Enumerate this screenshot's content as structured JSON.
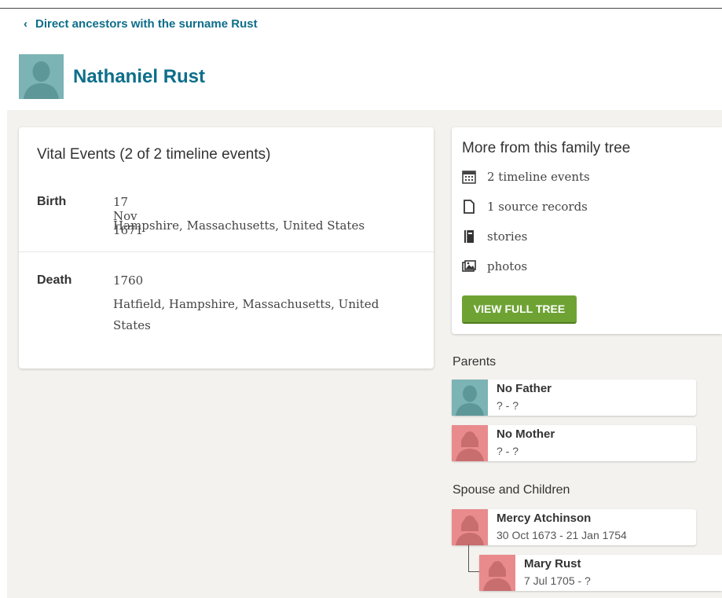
{
  "breadcrumb": {
    "label": "Direct ancestors with the surname Rust"
  },
  "person": {
    "name": "Nathaniel Rust"
  },
  "vital_events": {
    "title": "Vital Events (2 of 2 timeline events)",
    "events": [
      {
        "label": "Birth",
        "date": "17 Nov 1671",
        "place": "Hampshire, Massachusetts, United States"
      },
      {
        "label": "Death",
        "date": "1760",
        "place": "Hatfield, Hampshire, Massachusetts, United States"
      }
    ]
  },
  "more": {
    "title": "More from this family tree",
    "items": [
      {
        "icon": "calendar-icon",
        "label": "2 timeline events"
      },
      {
        "icon": "document-icon",
        "label": "1 source records"
      },
      {
        "icon": "book-icon",
        "label": "stories"
      },
      {
        "icon": "photos-icon",
        "label": "photos"
      }
    ],
    "button": "VIEW FULL TREE"
  },
  "parents": {
    "label": "Parents",
    "items": [
      {
        "name": "No Father",
        "dates": "? - ?",
        "gender": "male"
      },
      {
        "name": "No Mother",
        "dates": "? - ?",
        "gender": "female"
      }
    ]
  },
  "spouse_children": {
    "label": "Spouse and Children",
    "spouse": {
      "name": "Mercy Atchinson",
      "dates": "30 Oct 1673 - 21 Jan 1754",
      "gender": "female"
    },
    "children": [
      {
        "name": "Mary Rust",
        "dates": "7 Jul 1705 - ?",
        "gender": "female"
      }
    ]
  },
  "colors": {
    "link": "#0d6e8a",
    "button": "#6ea334",
    "male_avatar": "#7cb3b4",
    "female_avatar": "#e98b8c",
    "background": "#f3f2ee"
  }
}
